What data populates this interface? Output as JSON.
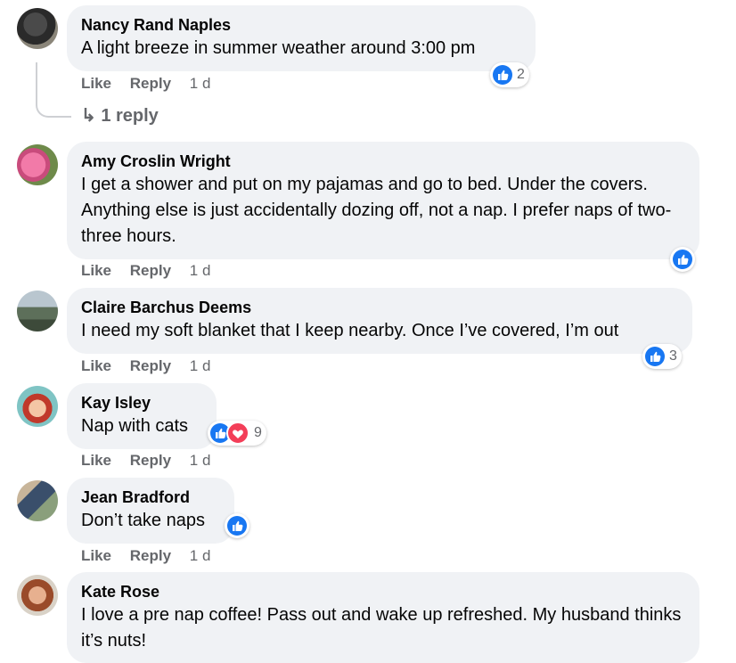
{
  "comments": [
    {
      "author": "Nancy Rand Naples",
      "text": "A light breeze in summer weather around 3:00 pm",
      "like": "Like",
      "reply": "Reply",
      "time": "1 d",
      "reaction_count": "2"
    },
    {
      "author": "Amy Croslin Wright",
      "text": "I get a shower and put on my pajamas and go to bed. Under the covers. Anything else is just accidentally dozing off, not a nap. I prefer naps of two-three hours.",
      "like": "Like",
      "reply": "Reply",
      "time": "1 d"
    },
    {
      "author": "Claire Barchus Deems",
      "text": "I need my soft blanket that I keep nearby. Once I’ve covered, I’m out",
      "like": "Like",
      "reply": "Reply",
      "time": "1 d",
      "reaction_count": "3"
    },
    {
      "author": "Kay Isley",
      "text": "Nap with cats",
      "like": "Like",
      "reply": "Reply",
      "time": "1 d",
      "reaction_count": "9"
    },
    {
      "author": "Jean Bradford",
      "text": "Don’t take naps",
      "like": "Like",
      "reply": "Reply",
      "time": "1 d"
    },
    {
      "author": "Kate Rose",
      "text": "I love a pre nap coffee! Pass out and wake up refreshed. My husband thinks it’s nuts!"
    }
  ],
  "replies_link": "↳ 1 reply",
  "colors": {
    "like_blue": "#1877f2",
    "love_red": "#f33e58",
    "bubble": "#f0f2f5",
    "meta": "#65676b"
  }
}
